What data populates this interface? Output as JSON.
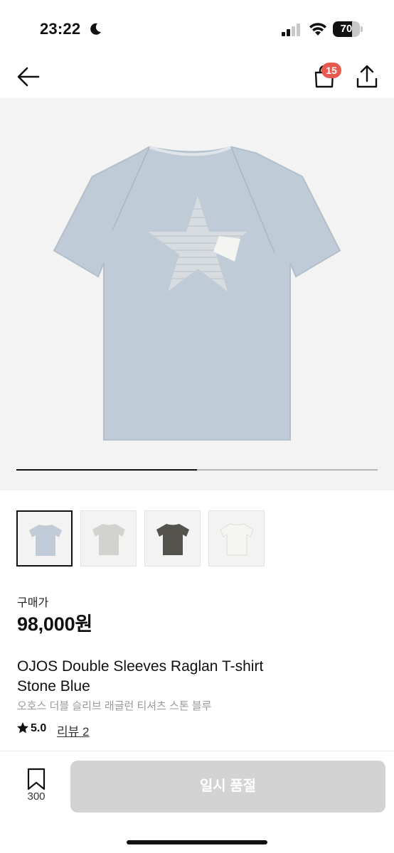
{
  "status_bar": {
    "time": "23:22",
    "battery_level": "70",
    "battery_fraction": 0.7
  },
  "nav": {
    "cart_badge": "15"
  },
  "gallery": {
    "progress_fraction": 0.5,
    "thumbnail_colors": [
      "#bfcbd6",
      "#d2d2cf",
      "#54524d",
      "#f5f5f2"
    ]
  },
  "product": {
    "price_label": "구매가",
    "price": "98,000원",
    "name_line1": "OJOS Double Sleeves Raglan T-shirt",
    "name_line2": "Stone Blue",
    "name_kr": "오호스 더블 슬리브 래글런 티셔츠 스톤 블루",
    "rating": "5.0",
    "review_link": "리뷰 2"
  },
  "bottom_bar": {
    "bookmark_count": "300",
    "soldout_label": "일시 품절"
  },
  "colors": {
    "accent_badge": "#e85a4f",
    "shirt": "#bfcbd6",
    "disabled_button": "#d3d3d3"
  }
}
